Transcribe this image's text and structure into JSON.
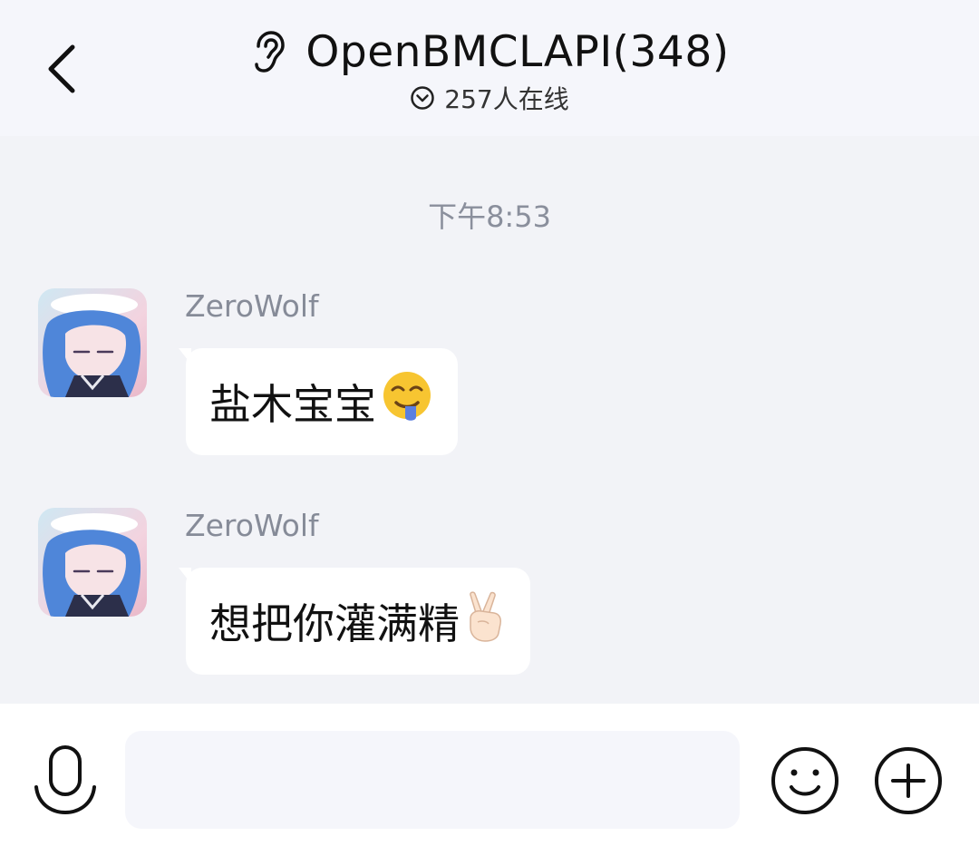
{
  "header": {
    "title": "OpenBMCLAPI(348)",
    "online_text": "257人在线",
    "icons": {
      "back": "chevron-left-icon",
      "ear": "ear-icon",
      "online": "chevron-circle-down-icon"
    }
  },
  "chat": {
    "timestamp": "下午8:53",
    "messages": [
      {
        "sender": "ZeroWolf",
        "text": "盐木宝宝",
        "emoji": "drooling-face-emoji"
      },
      {
        "sender": "ZeroWolf",
        "text": "想把你灌满精",
        "emoji": "victory-hand-emoji"
      }
    ]
  },
  "input_bar": {
    "placeholder": "",
    "icons": {
      "mic": "microphone-icon",
      "emoji": "smiley-icon",
      "plus": "plus-circle-icon"
    }
  },
  "colors": {
    "header_bg": "#f5f6fb",
    "chat_bg": "#f2f3f7",
    "bubble_bg": "#ffffff",
    "sender_text": "#868b98",
    "timestamp_text": "#8a8f9c"
  }
}
